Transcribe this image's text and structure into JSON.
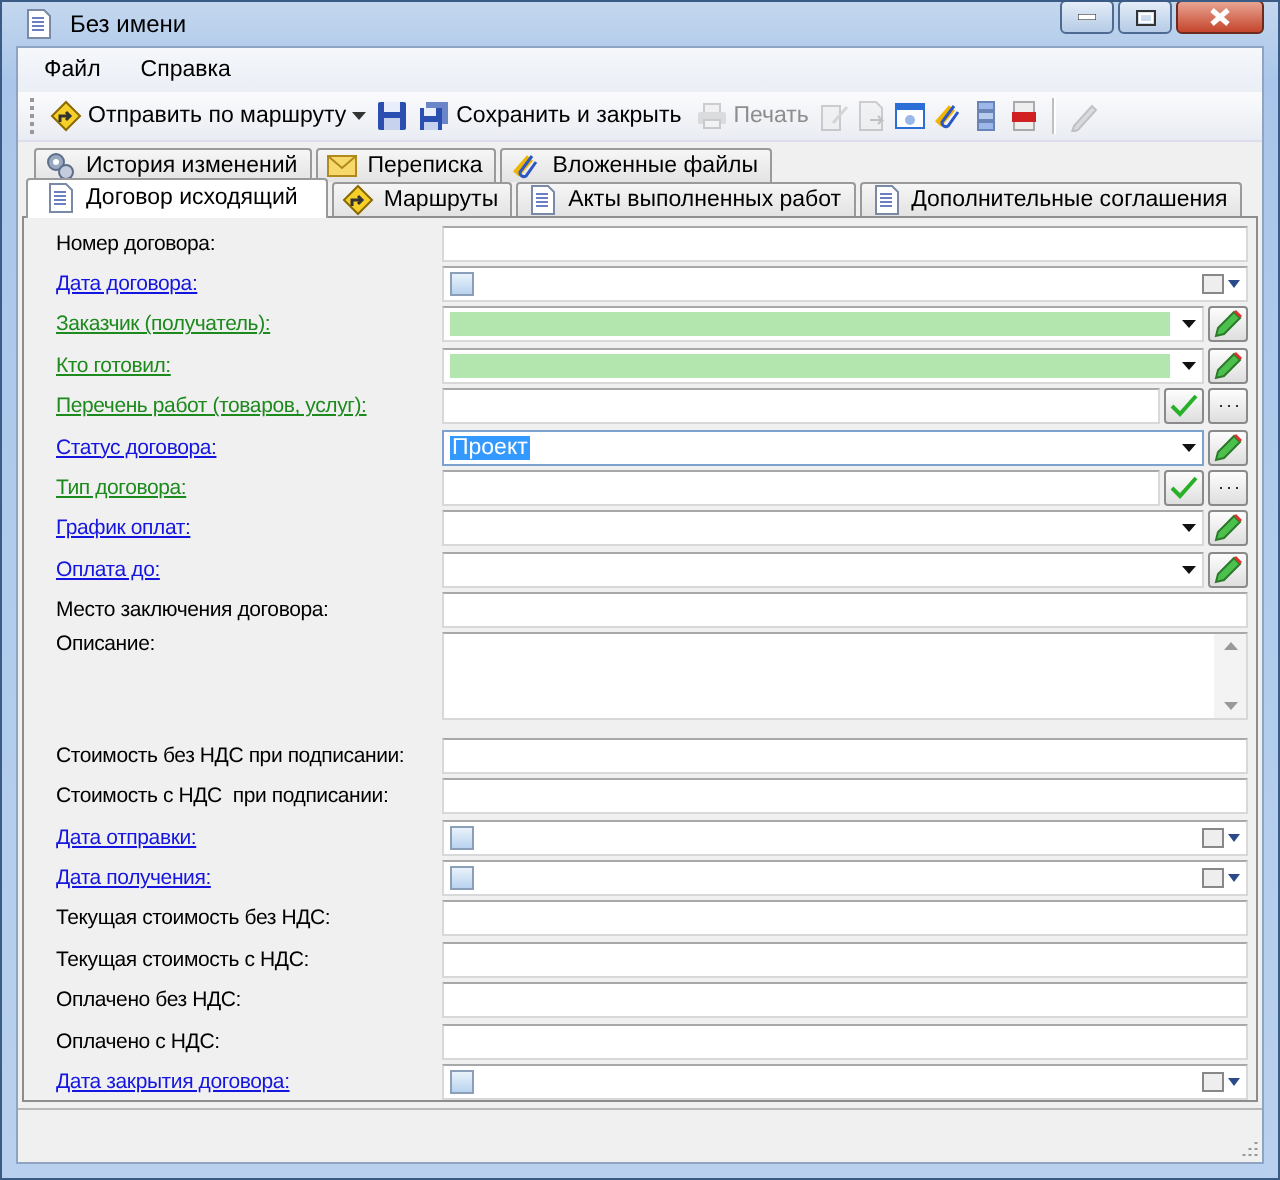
{
  "window": {
    "title": "Без имени"
  },
  "menu": [
    "Файл",
    "Справка"
  ],
  "toolbar": [
    {
      "kind": "button",
      "label": "Отправить по маршруту",
      "has_menu": true,
      "disabled": false
    },
    {
      "kind": "icon",
      "disabled": false
    },
    {
      "kind": "button",
      "label": "Сохранить и закрыть",
      "has_menu": false,
      "disabled": false
    },
    {
      "kind": "button",
      "label": "Печать",
      "has_menu": false,
      "disabled": true
    },
    {
      "kind": "icon",
      "disabled": true
    },
    {
      "kind": "icon",
      "disabled": true
    },
    {
      "kind": "icon",
      "disabled": false
    },
    {
      "kind": "icon",
      "disabled": false
    },
    {
      "kind": "icon",
      "disabled": false
    },
    {
      "kind": "icon",
      "disabled": false
    },
    {
      "kind": "separator"
    },
    {
      "kind": "icon",
      "disabled": true
    }
  ],
  "tab_rows": [
    [
      {
        "label": "История изменений",
        "selected": false
      },
      {
        "label": "Переписка",
        "selected": false
      },
      {
        "label": "Вложенные файлы",
        "selected": false
      }
    ],
    [
      {
        "label": "Договор исходящий",
        "selected": true
      },
      {
        "label": "Маршруты",
        "selected": false
      },
      {
        "label": "Акты выполненных работ",
        "selected": false
      },
      {
        "label": "Дополнительные соглашения",
        "selected": false
      }
    ]
  ],
  "fields": [
    {
      "label": "Номер договора:",
      "link": false,
      "required": false,
      "kind": "text",
      "focused": false
    },
    {
      "label": "Дата договора:",
      "link": true,
      "required": false,
      "kind": "date",
      "checked": false,
      "focused": false
    },
    {
      "label": "Заказчик (получатель):",
      "link": true,
      "required": true,
      "kind": "combo",
      "highlighted": true,
      "focused": false
    },
    {
      "label": "Кто готовил:",
      "link": true,
      "required": true,
      "kind": "combo",
      "highlighted": true,
      "focused": false
    },
    {
      "label": "Перечень работ (товаров, услуг):",
      "link": true,
      "required": true,
      "kind": "picker",
      "focused": false
    },
    {
      "label": "Статус договора:",
      "link": true,
      "required": false,
      "kind": "combo",
      "highlighted": false,
      "value": "Проект",
      "focused": true
    },
    {
      "label": "Тип договора:",
      "link": true,
      "required": true,
      "kind": "picker",
      "focused": false
    },
    {
      "label": "График оплат:",
      "link": true,
      "required": false,
      "kind": "combo",
      "highlighted": false,
      "focused": false
    },
    {
      "label": "Оплата до:",
      "link": true,
      "required": false,
      "kind": "combo",
      "highlighted": false,
      "focused": false
    },
    {
      "label": "Место заключения договора:",
      "link": false,
      "required": false,
      "kind": "text",
      "focused": false
    },
    {
      "label": "Описание:",
      "link": false,
      "required": false,
      "kind": "memo",
      "focused": false
    },
    {
      "label": "Стоимость без НДС при подписании:",
      "link": false,
      "required": false,
      "kind": "text",
      "focused": false
    },
    {
      "label": "Стоимость с НДС  при подписании:",
      "link": false,
      "required": false,
      "kind": "text",
      "focused": false
    },
    {
      "label": "Дата отправки:",
      "link": true,
      "required": false,
      "kind": "date",
      "checked": false,
      "focused": false
    },
    {
      "label": "Дата получения:",
      "link": true,
      "required": false,
      "kind": "date",
      "checked": false,
      "focused": false
    },
    {
      "label": "Текущая стоимость без НДС:",
      "link": false,
      "required": false,
      "kind": "text",
      "focused": false
    },
    {
      "label": "Текущая стоимость с НДС:",
      "link": false,
      "required": false,
      "kind": "text",
      "focused": false
    },
    {
      "label": "Оплачено без НДС:",
      "link": false,
      "required": false,
      "kind": "text",
      "focused": false
    },
    {
      "label": "Оплачено с НДС:",
      "link": false,
      "required": false,
      "kind": "text",
      "focused": false
    },
    {
      "label": "Дата закрытия договора:",
      "link": true,
      "required": false,
      "kind": "date",
      "checked": false,
      "focused": false
    }
  ]
}
